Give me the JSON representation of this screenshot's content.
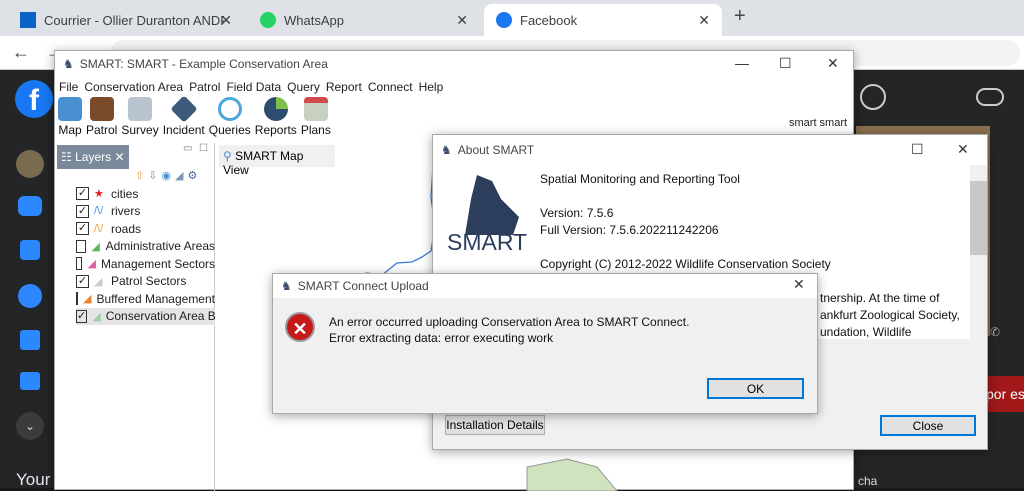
{
  "browser": {
    "tabs": [
      {
        "label": "Courrier - Ollier Duranton ANDRE",
        "icon": "outlook-icon"
      },
      {
        "label": "WhatsApp",
        "icon": "whatsapp-icon"
      },
      {
        "label": "Facebook",
        "icon": "facebook-icon",
        "active": true
      }
    ],
    "new_tab": "+",
    "address": "...",
    "fb_bottom_text": "Your",
    "fb_banner": "por est",
    "fb_profile": "smart smart",
    "fb_partial": "cha"
  },
  "smart": {
    "title": "SMART: SMART - Example Conservation Area",
    "menu": [
      "File",
      "Conservation Area",
      "Patrol",
      "Field Data",
      "Query",
      "Report",
      "Connect",
      "Help"
    ],
    "toolbar": [
      {
        "label": "Map",
        "color": "#4a8fd0"
      },
      {
        "label": "Patrol",
        "color": "#7b4a2a"
      },
      {
        "label": "Survey",
        "color": "#8aa0b8"
      },
      {
        "label": "Incident",
        "color": "#3d5a7a"
      },
      {
        "label": "Queries",
        "color": "#4aa7d8"
      },
      {
        "label": "Reports",
        "color": "#2e4d6e"
      },
      {
        "label": "Plans",
        "color": "#d04a4a"
      }
    ],
    "layers_tab": "Layers",
    "map_tab": "SMART Map View",
    "layers": [
      {
        "name": "cities",
        "checked": true,
        "icon": "★",
        "color": "#e02020"
      },
      {
        "name": "rivers",
        "checked": true,
        "icon": "/\\/",
        "color": "#4a90e2"
      },
      {
        "name": "roads",
        "checked": true,
        "icon": "/\\/",
        "color": "#f0a040"
      },
      {
        "name": "Administrative Areas",
        "checked": false,
        "icon": "◢",
        "color": "#5cb85c"
      },
      {
        "name": "Management Sectors",
        "checked": false,
        "icon": "◢",
        "color": "#e060a0"
      },
      {
        "name": "Patrol Sectors",
        "checked": true,
        "icon": "◢",
        "color": "#cccccc"
      },
      {
        "name": "Buffered Management",
        "checked": false,
        "icon": "◢",
        "color": "#f08030"
      },
      {
        "name": "Conservation Area Bo",
        "checked": true,
        "icon": "◢",
        "color": "#a0d0a0"
      }
    ]
  },
  "about": {
    "title": "About SMART",
    "logo_text": "SMART",
    "product": "Spatial Monitoring and Reporting Tool",
    "version": "Version: 7.5.6",
    "full_version": "Full Version: 7.5.6.202211242206",
    "copyright": "Copyright (C) 2012-2022 Wildlife Conservation Society",
    "text_lines": [
      "tnership. At the time of",
      "ankfurt Zoological Society,",
      "undation, Wildlife"
    ],
    "install_button": "Installation Details",
    "close_button": "Close"
  },
  "upload": {
    "title": "SMART Connect Upload",
    "message1": "An error occurred uploading Conservation Area to SMART Connect.",
    "message2": "Error extracting data: error executing work",
    "ok_button": "OK"
  }
}
